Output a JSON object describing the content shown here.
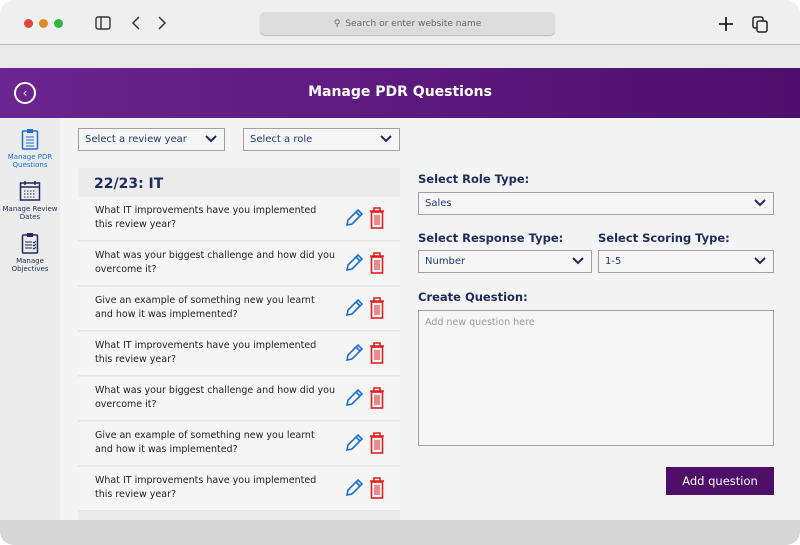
{
  "browser": {
    "search_placeholder": "Search or enter website name"
  },
  "header": {
    "title": "Manage PDR Questions"
  },
  "sidebar": {
    "items": [
      {
        "label": "Manage PDR Questions",
        "icon": "clipboard-list-icon",
        "active": true
      },
      {
        "label": "Manage Review Dates",
        "icon": "calendar-icon"
      },
      {
        "label": "Manage Objectives",
        "icon": "clipboard-check-icon"
      }
    ]
  },
  "filters": {
    "year": "Select a review year",
    "role": "Select a role"
  },
  "list": {
    "heading": "22/23: IT",
    "questions": [
      "What IT improvements have you implemented this review year?",
      "What was your biggest challenge and how did you overcome it?",
      "Give an example of something new you learnt and how it was implemented?",
      "What IT improvements have you implemented this review year?",
      "What was your biggest challenge and how did you overcome it?",
      "Give an example of something new you learnt and how it was implemented?",
      "What IT improvements have you implemented this review year?"
    ]
  },
  "form": {
    "role_type_label": "Select Role Type:",
    "role_type_value": "Sales",
    "response_type_label": "Select Response Type:",
    "response_type_value": "Number",
    "scoring_type_label": "Select Scoring Type:",
    "scoring_type_value": "1-5",
    "create_label": "Create Question:",
    "question_placeholder": "Add new question here",
    "add_button": "Add question"
  },
  "colors": {
    "brand": "#5a1778",
    "button": "#4f0f68",
    "edit": "#1a6fd6",
    "delete": "#e02020",
    "text_dark": "#1f2b5a"
  }
}
